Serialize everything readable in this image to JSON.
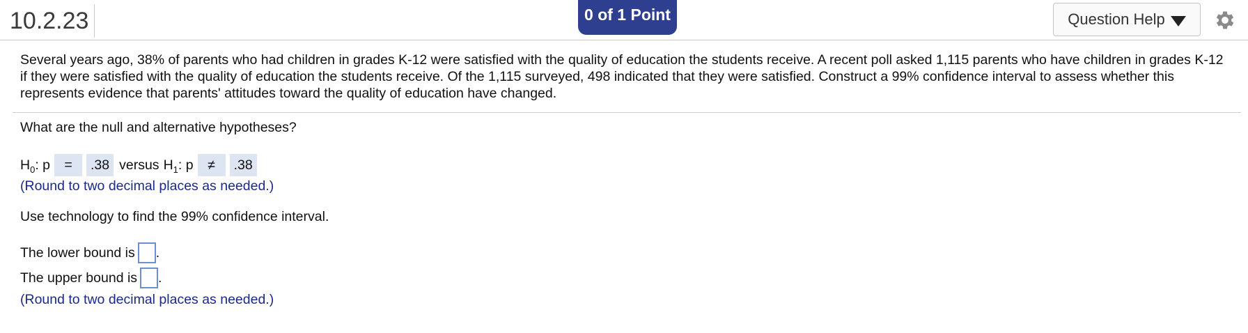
{
  "header": {
    "question_number": "10.2.23",
    "points": "0 of 1 Point",
    "help_label": "Question Help"
  },
  "problem": {
    "text": "Several years ago, 38% of parents who had children in grades K-12 were satisfied with the quality of education the students receive. A recent poll asked 1,115 parents who have children in grades K-12 if they were satisfied with the quality of education the students receive. Of the 1,115 surveyed, 498 indicated that they were satisfied. Construct a 99% confidence interval to assess whether this represents evidence that parents' attitudes toward the quality of education have changed."
  },
  "hypotheses": {
    "prompt": "What are the null and alternative hypotheses?",
    "h0_label": "H",
    "h0_sub": "0",
    "h0_var": ": p",
    "h0_symbol": "=",
    "h0_value": ".38",
    "versus": "versus",
    "h1_label": "H",
    "h1_sub": "1",
    "h1_var": ": p",
    "h1_symbol": "≠",
    "h1_value": ".38",
    "round_note": "(Round to two decimal places as needed.)"
  },
  "interval": {
    "prompt": "Use technology to find the 99% confidence interval.",
    "lower_label": "The lower bound is",
    "lower_value": "",
    "upper_label": "The upper bound is",
    "upper_value": "",
    "period": ".",
    "round_note": "(Round to two decimal places as needed.)"
  },
  "colors": {
    "points_badge": "#2f3f8f",
    "note_text": "#1a2a8a",
    "answer_fill": "#dde4f2",
    "input_border": "#6a8fd0"
  },
  "icons": [
    "chevron-down-icon",
    "gear-icon"
  ]
}
